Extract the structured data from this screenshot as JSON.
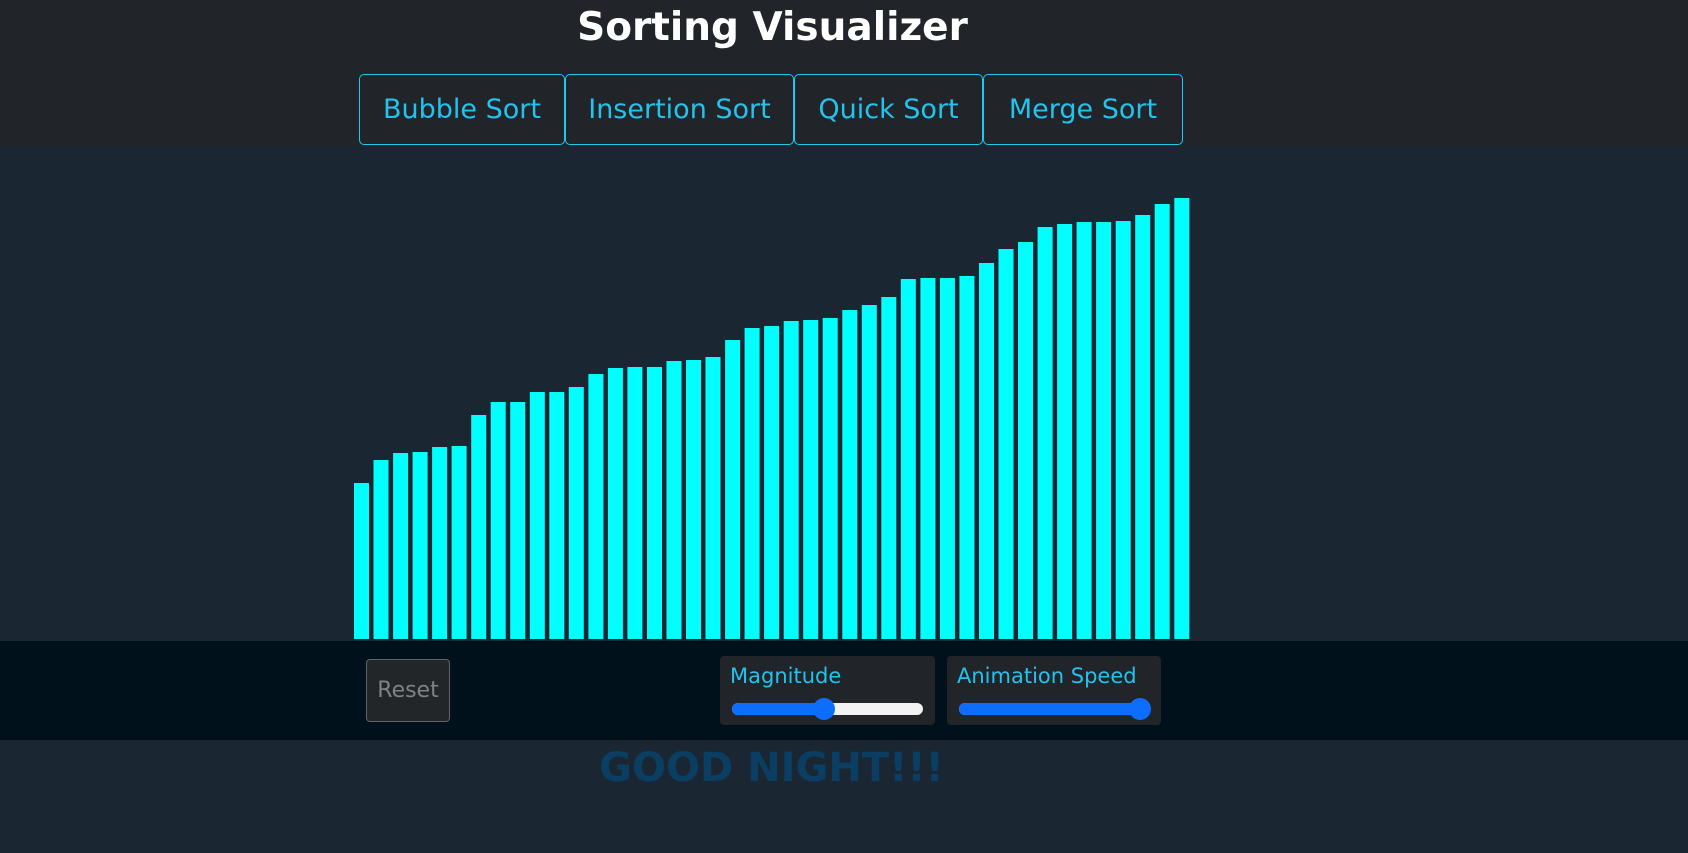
{
  "header": {
    "title": "Sorting Visualizer",
    "buttons": [
      "Bubble Sort",
      "Insertion Sort",
      "Quick Sort",
      "Merge Sort"
    ]
  },
  "bars": {
    "color": "#00ffff",
    "values": [
      156,
      179,
      186,
      187,
      192,
      193,
      224,
      237,
      237,
      247,
      247,
      252,
      265,
      271,
      272,
      272,
      278,
      279,
      282,
      299,
      311,
      313,
      318,
      319,
      321,
      329,
      334,
      342,
      360,
      361,
      361,
      363,
      376,
      390,
      397,
      412,
      415,
      417,
      417,
      418,
      424,
      435,
      441
    ]
  },
  "controls": {
    "reset_label": "Reset",
    "magnitude": {
      "label": "Magnitude",
      "value_fraction": 0.48
    },
    "speed": {
      "label": "Animation Speed",
      "value_fraction": 0.95
    }
  },
  "message": "GOOD NIGHT!!!",
  "colors": {
    "accent": "#22c3ee",
    "bar": "#00ffff",
    "slider": "#0d6efd",
    "message": "#0b3e63"
  }
}
